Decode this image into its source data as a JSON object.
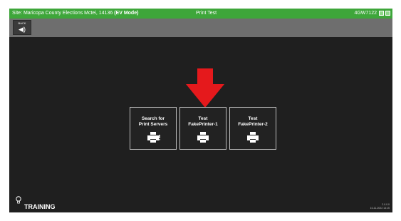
{
  "titlebar": {
    "site": "Site: Maricopa County Elections Mctei, 14136",
    "mode": "(EV Mode)",
    "center": "Print Test",
    "right": "4GW7122"
  },
  "toolbar": {
    "back_label": "BACK",
    "back_icon": "speaker-icon"
  },
  "tiles": [
    {
      "label": "Search for\nPrint Servers",
      "icon": "printer-search-icon"
    },
    {
      "label": "Test\nFakePrinter-1",
      "icon": "printer-icon"
    },
    {
      "label": "Test\nFakePrinter-2",
      "icon": "printer-icon"
    }
  ],
  "footer": {
    "training": "TRAINING",
    "version": "2.0.0.0",
    "datetime": "10-11-2022 14:15"
  },
  "colors": {
    "titlebar": "#3ea63a",
    "toolbar": "#6e6e6e",
    "background": "#1f1f1f",
    "arrow": "#e5191c"
  }
}
